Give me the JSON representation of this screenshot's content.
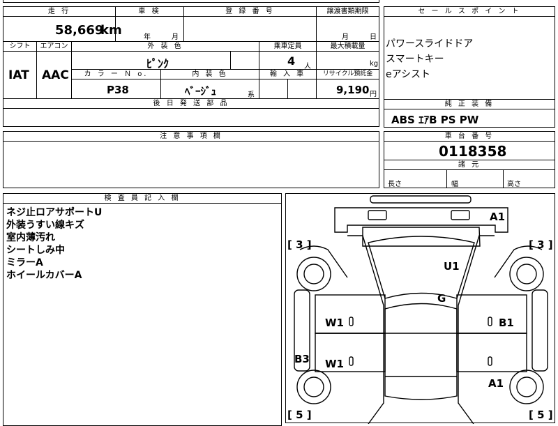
{
  "labels": {
    "mileage": "走 行",
    "inspection": "車 検",
    "registration": "登 録 番 号",
    "transfer_docs": "譲渡書類期限",
    "sales_points": "セ ー ル ス ポ イ ン ト",
    "shift": "シフト",
    "aircon": "エアコン",
    "exterior_color": "外 装 色",
    "capacity": "乗車定員",
    "max_load": "最大積載量",
    "color_no": "カ ラ ー Ｎ o.",
    "interior_color": "内 装 色",
    "import": "輸 入 車",
    "recycle": "リサイクル預託金",
    "later_parts": "後 日 発 送 部 品",
    "genuine_equipment": "純 正 装 備",
    "notes": "注 意 事 項 欄",
    "chassis_no": "車 台 番 号",
    "dimensions": "諸 元",
    "inspector_notes": "検 査 員 記 入 欄"
  },
  "values": {
    "mileage": "58,669",
    "mileage_unit": "km",
    "year_label": "年",
    "month_label": "月",
    "transfer_month": "月",
    "transfer_day": "日",
    "shift": "IAT",
    "aircon": "AAC",
    "exterior_color": "ﾋﾟﾝｸ",
    "capacity": "4",
    "capacity_unit": "人",
    "max_load_unit": "kg",
    "color_no": "P38",
    "interior_color": "ﾍﾞｰｼﾞｭ",
    "interior_suffix": "系",
    "recycle_fee": "9,190",
    "recycle_unit": "円",
    "genuine_equipment": "ABS ｴｱB PS PW",
    "chassis_no": "0118358",
    "length": "長さ",
    "width": "幅",
    "height": "高さ"
  },
  "sales_points": [
    "パワースライドドア",
    "スマートキー",
    "eアシスト"
  ],
  "inspector_notes": [
    "ネジ止ロアサポートU",
    "外装うすい線キズ",
    "室内薄汚れ",
    "シートしみ中",
    "ミラーA",
    "ホイールカバーA"
  ],
  "diagram": {
    "bracket_left_top": "[ 3 ]",
    "bracket_right_top": "[ 3 ]",
    "bracket_left_bottom": "[ 5 ]",
    "bracket_right_bottom": "[ 5 ]",
    "mark_a1_top": "A1",
    "mark_u1": "U1",
    "mark_g": "G",
    "mark_w1_front": "W1",
    "mark_b1": "B1",
    "mark_b3": "B3",
    "mark_w1_rear": "W1",
    "mark_a1_bottom": "A1"
  }
}
